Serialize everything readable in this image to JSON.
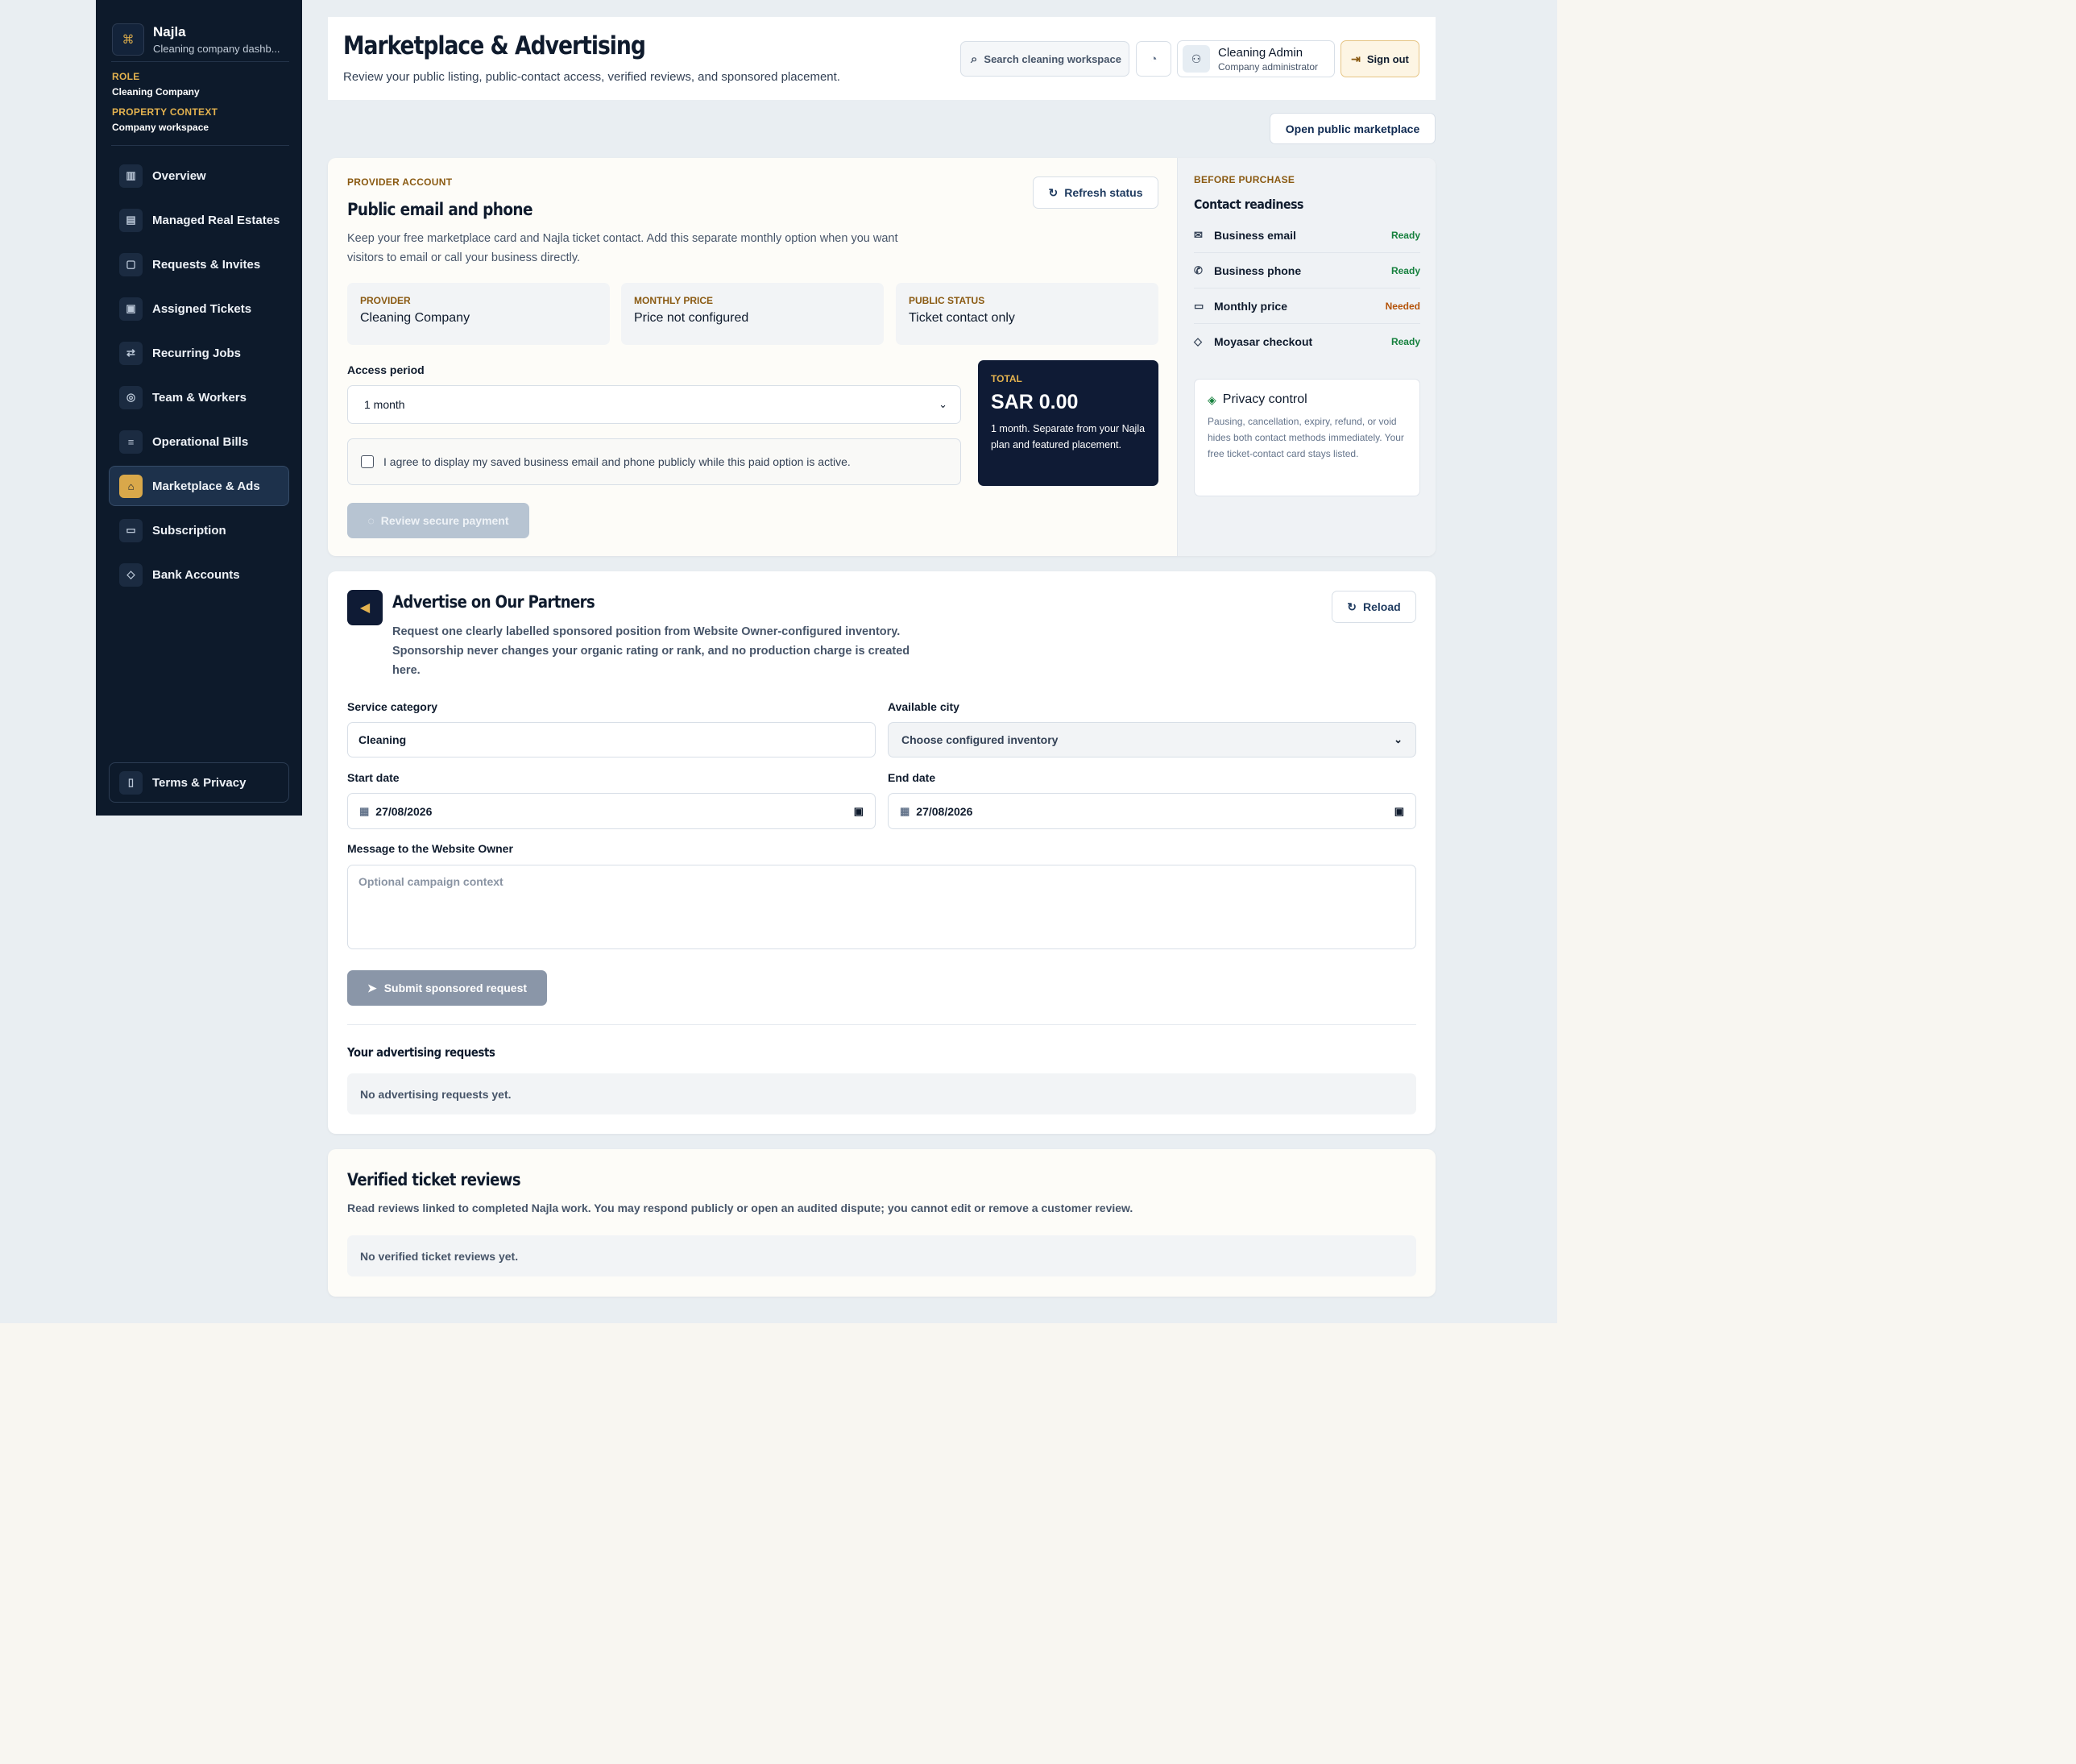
{
  "sidebar": {
    "brand_name": "Najla",
    "brand_sub": "Cleaning company dashb...",
    "role_label": "ROLE",
    "role_value": "Cleaning Company",
    "context_label": "PROPERTY CONTEXT",
    "context_value": "Company workspace",
    "items": [
      {
        "label": "Overview",
        "icon": "bar-chart-icon"
      },
      {
        "label": "Managed Real Estates",
        "icon": "building-icon"
      },
      {
        "label": "Requests & Invites",
        "icon": "clipboard-icon"
      },
      {
        "label": "Assigned Tickets",
        "icon": "clipboard-check-icon"
      },
      {
        "label": "Recurring Jobs",
        "icon": "repeat-icon"
      },
      {
        "label": "Team & Workers",
        "icon": "users-icon"
      },
      {
        "label": "Operational Bills",
        "icon": "receipt-icon"
      },
      {
        "label": "Marketplace & Ads",
        "icon": "store-icon",
        "active": true
      },
      {
        "label": "Subscription",
        "icon": "card-icon"
      },
      {
        "label": "Bank Accounts",
        "icon": "shield-icon"
      }
    ],
    "terms": "Terms & Privacy"
  },
  "header": {
    "title": "Marketplace & Advertising",
    "subtitle": "Review your public listing, public-contact access, verified reviews, and sponsored placement.",
    "search_placeholder": "Search cleaning workspace",
    "user_name": "Cleaning Admin",
    "user_role": "Company administrator",
    "sign_out": "Sign out"
  },
  "open_marketplace": "Open public marketplace",
  "provider": {
    "eyebrow": "PROVIDER ACCOUNT",
    "title": "Public email and phone",
    "description": "Keep your free marketplace card and Najla ticket contact. Add this separate monthly option when you want visitors to email or call your business directly.",
    "refresh": "Refresh status",
    "stats": [
      {
        "label": "PROVIDER",
        "value": "Cleaning Company"
      },
      {
        "label": "MONTHLY PRICE",
        "value": "Price not configured"
      },
      {
        "label": "PUBLIC STATUS",
        "value": "Ticket contact only"
      }
    ],
    "access_label": "Access period",
    "access_value": "1 month",
    "agree_text": "I agree to display my saved business email and phone publicly while this paid option is active.",
    "total_label": "TOTAL",
    "total_value": "SAR 0.00",
    "total_note": "1 month. Separate from your Najla plan and featured placement.",
    "review_button": "Review secure payment"
  },
  "readiness": {
    "eyebrow": "BEFORE PURCHASE",
    "title": "Contact readiness",
    "items": [
      {
        "label": "Business email",
        "status": "Ready",
        "icon": "mail-icon"
      },
      {
        "label": "Business phone",
        "status": "Ready",
        "icon": "phone-icon"
      },
      {
        "label": "Monthly price",
        "status": "Needed",
        "icon": "card-icon"
      },
      {
        "label": "Moyasar checkout",
        "status": "Ready",
        "icon": "shield-icon"
      }
    ],
    "privacy_title": "Privacy control",
    "privacy_text": "Pausing, cancellation, expiry, refund, or void hides both contact methods immediately. Your free ticket-contact card stays listed."
  },
  "advertise": {
    "title": "Advertise on Our Partners",
    "description": "Request one clearly labelled sponsored position from Website Owner-configured inventory. Sponsorship never changes your organic rating or rank, and no production charge is created here.",
    "reload": "Reload",
    "category_label": "Service category",
    "category_value": "Cleaning",
    "city_label": "Available city",
    "city_value": "Choose configured inventory",
    "start_label": "Start date",
    "start_value": "27/08/2026",
    "end_label": "End date",
    "end_value": "27/08/2026",
    "message_label": "Message to the Website Owner",
    "message_placeholder": "Optional campaign context",
    "submit": "Submit sponsored request",
    "requests_title": "Your advertising requests",
    "requests_empty": "No advertising requests yet."
  },
  "reviews": {
    "title": "Verified ticket reviews",
    "description": "Read reviews linked to completed Najla work. You may respond publicly or open an audited dispute; you cannot edit or remove a customer review.",
    "empty": "No verified ticket reviews yet."
  },
  "colors": {
    "navy": "#0d1a2b",
    "gold": "#d9a84a",
    "ready": "#15803d",
    "needed": "#b45309"
  }
}
